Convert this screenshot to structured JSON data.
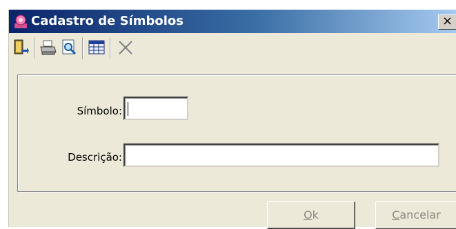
{
  "window": {
    "title": "Cadastro de Símbolos",
    "close_glyph": "×"
  },
  "toolbar": {
    "buttons": [
      {
        "icon": "exit-door-icon"
      },
      {
        "icon": "printer-icon"
      },
      {
        "icon": "print-preview-icon"
      },
      {
        "icon": "table-grid-icon"
      },
      {
        "icon": "delete-x-icon"
      }
    ]
  },
  "form": {
    "simbolo_label": "Símbolo:",
    "simbolo_value": "",
    "descricao_label": "Descrição:",
    "descricao_value": ""
  },
  "buttons": {
    "ok_mnemonic": "O",
    "ok_rest": "k",
    "cancel_mnemonic": "C",
    "cancel_rest": "ancelar"
  },
  "colors": {
    "title_bar_start": "#0a246a",
    "title_bar_end": "#a6caf0",
    "window_face": "#ece9d8"
  }
}
